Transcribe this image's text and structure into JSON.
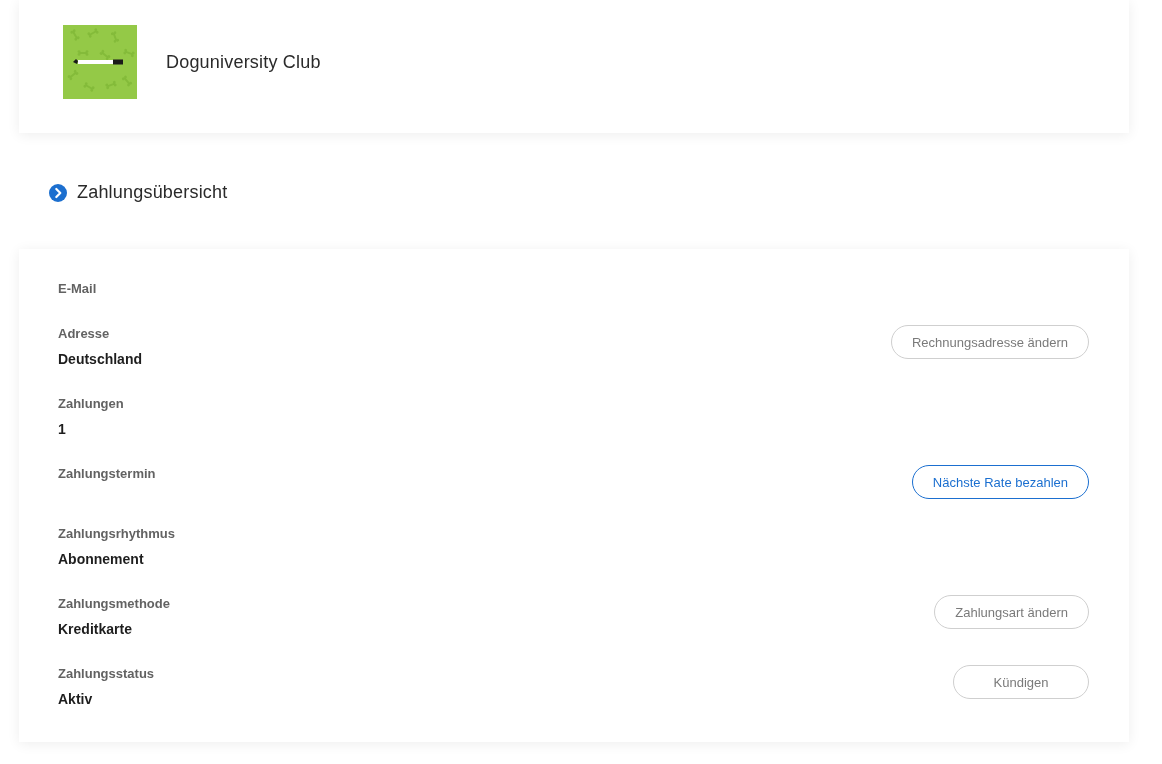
{
  "club": {
    "name": "Doguniversity Club"
  },
  "section": {
    "title": "Zahlungsübersicht"
  },
  "details": [
    {
      "label": "E-Mail"
    },
    {
      "label": "Adresse",
      "value": "Deutschland",
      "action": {
        "label": "Rechnungsadresse ändern",
        "kind": "secondary"
      }
    },
    {
      "label": "Zahlungen",
      "value": "1"
    },
    {
      "label": "Zahlungstermin",
      "action": {
        "label": "Nächste Rate bezahlen",
        "kind": "primary"
      }
    },
    {
      "label": "Zahlungsrhythmus",
      "value": "Abonnement"
    },
    {
      "label": "Zahlungsmethode",
      "value": "Kreditkarte",
      "action": {
        "label": "Zahlungsart ändern",
        "kind": "secondary"
      }
    },
    {
      "label": "Zahlungsstatus",
      "value": "Aktiv",
      "action": {
        "label": "Kündigen",
        "kind": "secondary"
      }
    }
  ]
}
